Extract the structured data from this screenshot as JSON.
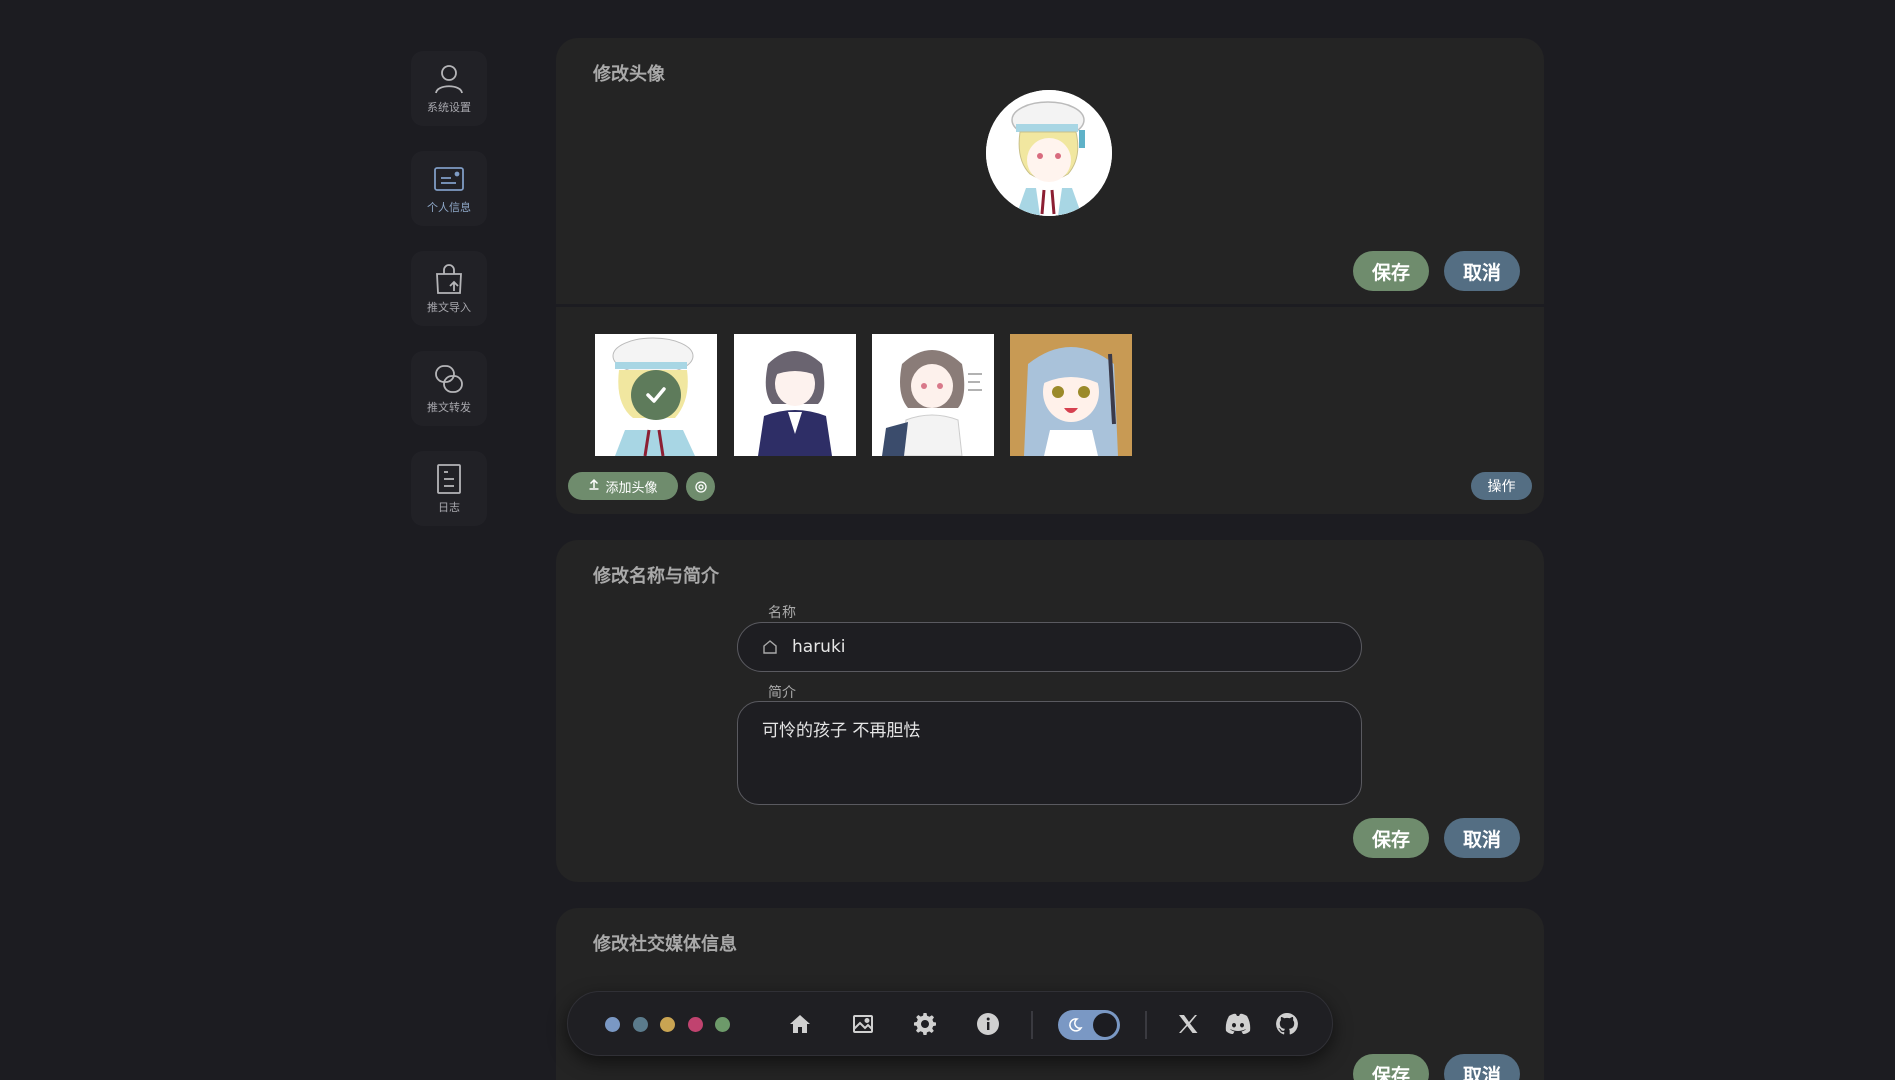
{
  "sidebar": {
    "items": [
      {
        "label": "系统设置",
        "icon": "user-icon"
      },
      {
        "label": "个人信息",
        "icon": "id-card-icon"
      },
      {
        "label": "推文导入",
        "icon": "bag-upload-icon"
      },
      {
        "label": "推文转发",
        "icon": "forward-icon"
      },
      {
        "label": "日志",
        "icon": "document-icon"
      }
    ],
    "active": "个人信息"
  },
  "avatar_card": {
    "title": "修改头像",
    "save_label": "保存",
    "cancel_label": "取消",
    "add_label": "添加头像",
    "operate_label": "操作",
    "thumbnails": [
      "avatar-1",
      "avatar-2",
      "avatar-3",
      "avatar-4"
    ],
    "selected_index": 0
  },
  "name_card": {
    "title": "修改名称与简介",
    "name_label": "名称",
    "name_value": "haruki",
    "bio_label": "简介",
    "bio_value": "可怜的孩子 不再胆怯",
    "save_label": "保存",
    "cancel_label": "取消"
  },
  "social_card": {
    "title": "修改社交媒体信息",
    "save_label": "保存",
    "cancel_label": "取消"
  },
  "dock": {
    "theme_colors": [
      "#7a98c4",
      "#5b7b8c",
      "#c9a452",
      "#c0436f",
      "#6d9a6a"
    ],
    "icons": [
      "home-icon",
      "image-icon",
      "gear-icon",
      "info-icon",
      "x-icon",
      "discord-icon",
      "github-icon"
    ],
    "dark_mode": true
  },
  "colors": {
    "background": "#1c1c21",
    "card": "#242424",
    "save": "#6f8c6d",
    "cancel": "#546e83",
    "accent": "#7a98c4"
  }
}
